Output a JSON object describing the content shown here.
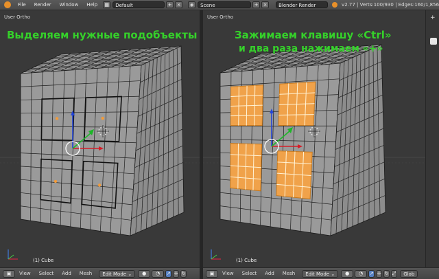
{
  "topbar": {
    "menus": [
      "File",
      "Render",
      "Window",
      "Help"
    ],
    "layout": "Default",
    "scene": "Scene",
    "engine": "Blender Render",
    "stats": "v2.77 | Verts:100/930 | Edges:160/1,856"
  },
  "left_view": {
    "title": "User Ortho",
    "caption": "Выделяем нужные подобъекты",
    "object": "(1) Cube"
  },
  "right_view": {
    "title": "User Ortho",
    "caption_line1": "Зажимаем клавишу «Ctrl»",
    "caption_line2": "и два раза нажимаем «+»",
    "object": "(1) Cube"
  },
  "header": {
    "view": "View",
    "select": "Select",
    "add": "Add",
    "mesh": "Mesh",
    "mode": "Edit Mode",
    "glob": "Glob"
  },
  "colors": {
    "caption": "#35d12a",
    "face_select": "#f0a24a",
    "cube_face": "#9c9c9c"
  }
}
